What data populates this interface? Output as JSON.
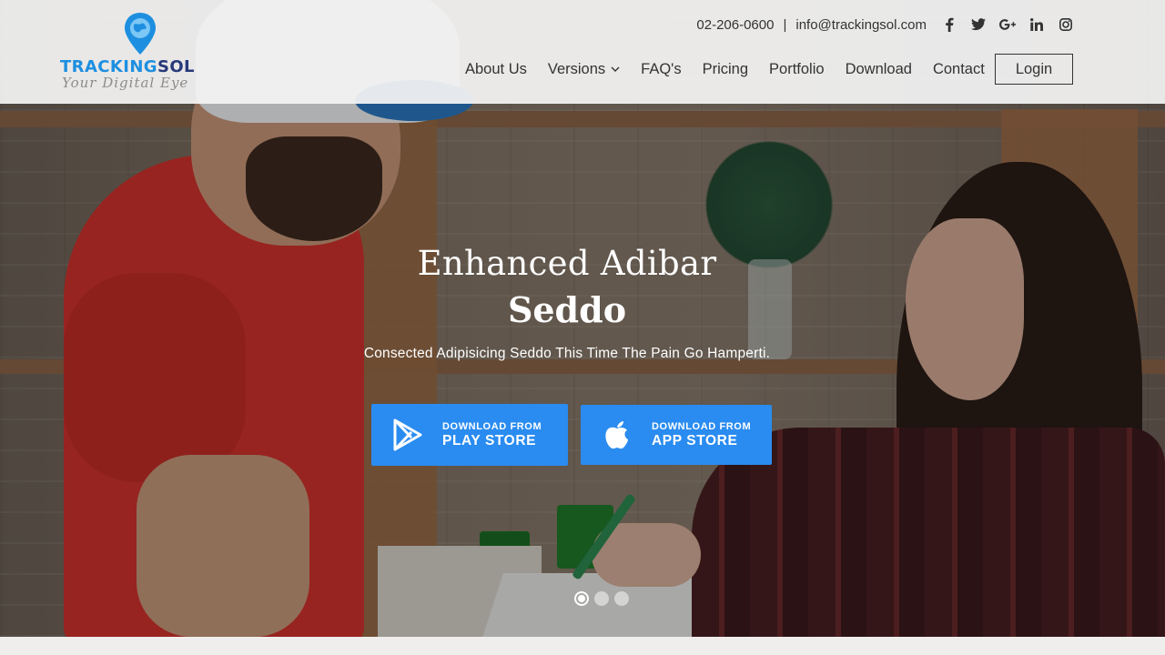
{
  "header": {
    "logo": {
      "brand_part1": "TRACKING",
      "brand_part2": "SOL",
      "tagline": "Your Digital Eye"
    },
    "contact": {
      "phone": "02-206-0600",
      "separator": "|",
      "email": "info@trackingsol.com"
    },
    "socials": [
      {
        "icon": "facebook-icon"
      },
      {
        "icon": "twitter-icon"
      },
      {
        "icon": "google-plus-icon"
      },
      {
        "icon": "linkedin-icon"
      },
      {
        "icon": "instagram-icon"
      }
    ],
    "nav": [
      {
        "label": "About Us"
      },
      {
        "label": "Versions",
        "has_dropdown": true
      },
      {
        "label": "FAQ's"
      },
      {
        "label": "Pricing"
      },
      {
        "label": "Portfolio"
      },
      {
        "label": "Download"
      },
      {
        "label": "Contact"
      }
    ],
    "login_label": "Login"
  },
  "hero": {
    "title_line1": "Enhanced Adibar",
    "title_line2": "Seddo",
    "subtitle": "Consected Adipisicing Seddo This Time The Pain Go Hamperti.",
    "buttons": {
      "play": {
        "small": "DOWNLOAD FROM",
        "big": "PLAY STORE",
        "icon": "play-store-icon"
      },
      "apple": {
        "small": "DOWNLOAD FROM",
        "big": "APP STORE",
        "icon": "apple-icon"
      }
    },
    "slider": {
      "count": 3,
      "active_index": 0
    }
  },
  "colors": {
    "accent": "#2a8cf0",
    "logo_blue": "#1e8fe0",
    "logo_dark": "#27397a",
    "header_bg": "#f4f4f4"
  }
}
